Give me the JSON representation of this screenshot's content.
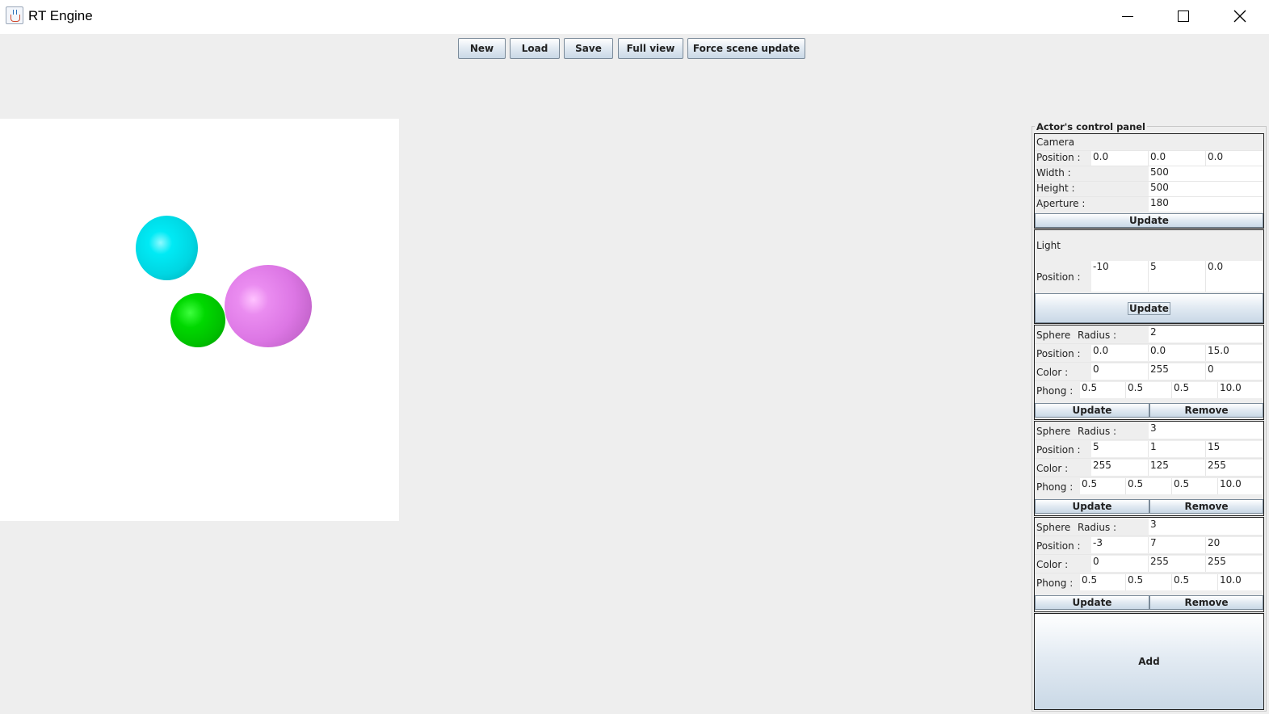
{
  "window": {
    "title": "RT Engine",
    "icon": "java-cup-icon"
  },
  "toolbar": {
    "new_label": "New",
    "load_label": "Load",
    "save_label": "Save",
    "full_view_label": "Full view",
    "force_update_label": "Force scene update"
  },
  "viewport": {
    "spheres": [
      {
        "name": "cyan-sphere",
        "color": "#00e5ee"
      },
      {
        "name": "green-sphere",
        "color": "#00d000"
      },
      {
        "name": "magenta-sphere",
        "color": "#e07ee8"
      }
    ]
  },
  "panel": {
    "title": "Actor's control panel",
    "camera": {
      "heading": "Camera",
      "position_label": "Position :",
      "position": [
        "0.0",
        "0.0",
        "0.0"
      ],
      "width_label": "Width :",
      "width": "500",
      "height_label": "Height :",
      "height": "500",
      "aperture_label": "Aperture :",
      "aperture": "180",
      "update_label": "Update"
    },
    "light": {
      "heading": "Light",
      "position_label": "Position :",
      "position": [
        "-10",
        "5",
        "0.0"
      ],
      "update_label": "Update"
    },
    "spheres": [
      {
        "heading": "Sphere",
        "radius_label": "Radius :",
        "radius": "2",
        "position_label": "Position :",
        "position": [
          "0.0",
          "0.0",
          "15.0"
        ],
        "color_label": "Color :",
        "color": [
          "0",
          "255",
          "0"
        ],
        "phong_label": "Phong :",
        "phong": [
          "0.5",
          "0.5",
          "0.5",
          "10.0"
        ],
        "update_label": "Update",
        "remove_label": "Remove"
      },
      {
        "heading": "Sphere",
        "radius_label": "Radius :",
        "radius": "3",
        "position_label": "Position :",
        "position": [
          "5",
          "1",
          "15"
        ],
        "color_label": "Color :",
        "color": [
          "255",
          "125",
          "255"
        ],
        "phong_label": "Phong :",
        "phong": [
          "0.5",
          "0.5",
          "0.5",
          "10.0"
        ],
        "update_label": "Update",
        "remove_label": "Remove"
      },
      {
        "heading": "Sphere",
        "radius_label": "Radius :",
        "radius": "3",
        "position_label": "Position :",
        "position": [
          "-3",
          "7",
          "20"
        ],
        "color_label": "Color :",
        "color": [
          "0",
          "255",
          "255"
        ],
        "phong_label": "Phong :",
        "phong": [
          "0.5",
          "0.5",
          "0.5",
          "10.0"
        ],
        "update_label": "Update",
        "remove_label": "Remove"
      }
    ],
    "add_label": "Add"
  }
}
